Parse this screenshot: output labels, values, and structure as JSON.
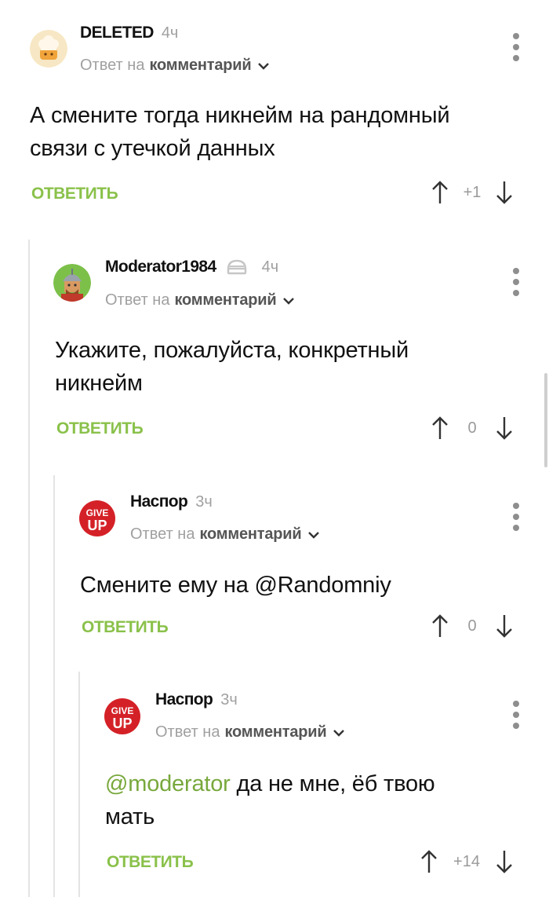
{
  "comments": [
    {
      "author": "DELETED",
      "time": "4ч",
      "reply_prefix": "Ответ на",
      "reply_target": "комментарий",
      "text_lines": [
        "А смените тогда никнейм на рандомный",
        "связи с утечкой данных"
      ],
      "reply_label": "ОТВЕТИТЬ",
      "score": "+1",
      "avatar_icon": "chef-hat-avatar-icon"
    },
    {
      "author": "Moderator1984",
      "time": "4ч",
      "reply_prefix": "Ответ на",
      "reply_target": "комментарий",
      "text_lines": [
        "Укажите, пожалуйста, конкретный",
        "никнейм"
      ],
      "reply_label": "ОТВЕТИТЬ",
      "score": "0",
      "avatar_icon": "knight-avatar-icon",
      "badge_icon": "moderator-badge-icon"
    },
    {
      "author": "Наспор",
      "time": "3ч",
      "reply_prefix": "Ответ на",
      "reply_target": "комментарий",
      "text_lines": [
        "Смените ему на @Randomniy"
      ],
      "reply_label": "ОТВЕТИТЬ",
      "score": "0",
      "avatar_icon": "give-up-avatar-icon"
    },
    {
      "author": "Наспор",
      "time": "3ч",
      "reply_prefix": "Ответ на",
      "reply_target": "комментарий",
      "mention": "@moderator",
      "text_rest": " да не мне, ёб твою",
      "text_line2": "мать",
      "reply_label": "ОТВЕТИТЬ",
      "score": "+14",
      "avatar_icon": "give-up-avatar-icon"
    }
  ],
  "avatar_texts": {
    "give_up_top": "GIVE",
    "give_up_bottom": "UP"
  },
  "colors": {
    "accent_green": "#8ac14a",
    "mention_green": "#78a83c",
    "give_up_red": "#d42127"
  }
}
